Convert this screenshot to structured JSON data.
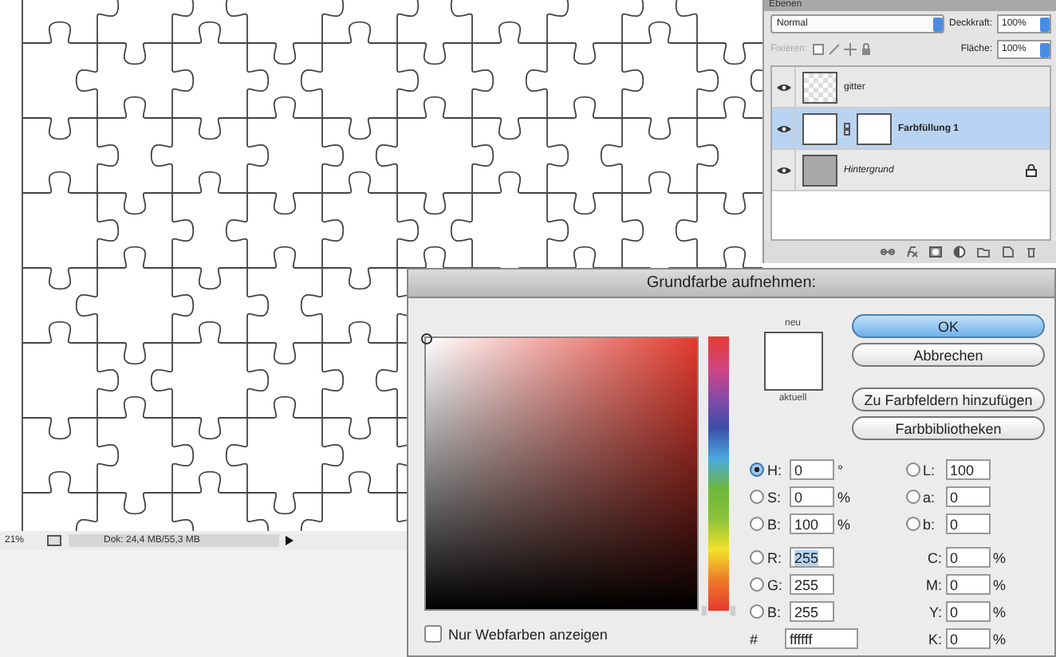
{
  "layers_panel": {
    "title": "Ebenen",
    "blend_mode": "Normal",
    "opacity_label": "Deckkraft:",
    "opacity": "100%",
    "lock_label": "Fixieren:",
    "fill_label": "Fläche:",
    "fill": "100%",
    "layers": [
      {
        "name": "gitter",
        "kind": "pattern",
        "selected": false,
        "visible": true,
        "locked": false
      },
      {
        "name": "Farbfüllung 1",
        "kind": "fill",
        "selected": true,
        "visible": true,
        "locked": false
      },
      {
        "name": "Hintergrund",
        "kind": "background",
        "selected": false,
        "visible": true,
        "locked": true
      }
    ]
  },
  "status_bar": {
    "zoom": "21%",
    "doc_info": "Dok: 24,4 MB/55,3 MB"
  },
  "dialog": {
    "title": "Grundfarbe aufnehmen:",
    "new_label": "neu",
    "current_label": "aktuell",
    "buttons": [
      {
        "label": "OK",
        "default": true
      },
      {
        "label": "Abbrechen",
        "default": false
      },
      {
        "label": "Zu Farbfeldern hinzufügen",
        "default": false
      },
      {
        "label": "Farbbibliotheken",
        "default": false
      }
    ],
    "fields_left": [
      {
        "kind": "radio",
        "label": "H:",
        "value": "0",
        "unit": "°",
        "selected": true,
        "highlighted": false
      },
      {
        "kind": "radio",
        "label": "S:",
        "value": "0",
        "unit": "%",
        "selected": false,
        "highlighted": false
      },
      {
        "kind": "radio",
        "label": "B:",
        "value": "100",
        "unit": "%",
        "selected": false,
        "highlighted": false
      },
      {
        "kind": "radio",
        "label": "R:",
        "value": "255",
        "selected": false,
        "highlighted": true
      },
      {
        "kind": "radio",
        "label": "G:",
        "value": "255",
        "selected": false,
        "highlighted": false
      },
      {
        "kind": "radio",
        "label": "B:",
        "value": "255",
        "selected": false,
        "highlighted": false
      },
      {
        "kind": "hex",
        "label": "#",
        "value": "ffffff",
        "highlighted": false
      }
    ],
    "fields_right": [
      {
        "kind": "radio",
        "label": "L:",
        "value": "100",
        "selected": false,
        "highlighted": false
      },
      {
        "kind": "radio",
        "label": "a:",
        "value": "0",
        "selected": false,
        "highlighted": false
      },
      {
        "kind": "radio",
        "label": "b:",
        "value": "0",
        "selected": false,
        "highlighted": false
      },
      {
        "kind": "plain",
        "label": "C:",
        "value": "0",
        "unit": "%",
        "highlighted": false
      },
      {
        "kind": "plain",
        "label": "M:",
        "value": "0",
        "unit": "%",
        "highlighted": false
      },
      {
        "kind": "plain",
        "label": "Y:",
        "value": "0",
        "unit": "%",
        "highlighted": false
      },
      {
        "kind": "plain",
        "label": "K:",
        "value": "0",
        "unit": "%",
        "highlighted": false
      }
    ],
    "hue_slider": {
      "level": 0
    },
    "web_colors": {
      "label": "Nur Webfarben anzeigen",
      "checked": false
    }
  }
}
